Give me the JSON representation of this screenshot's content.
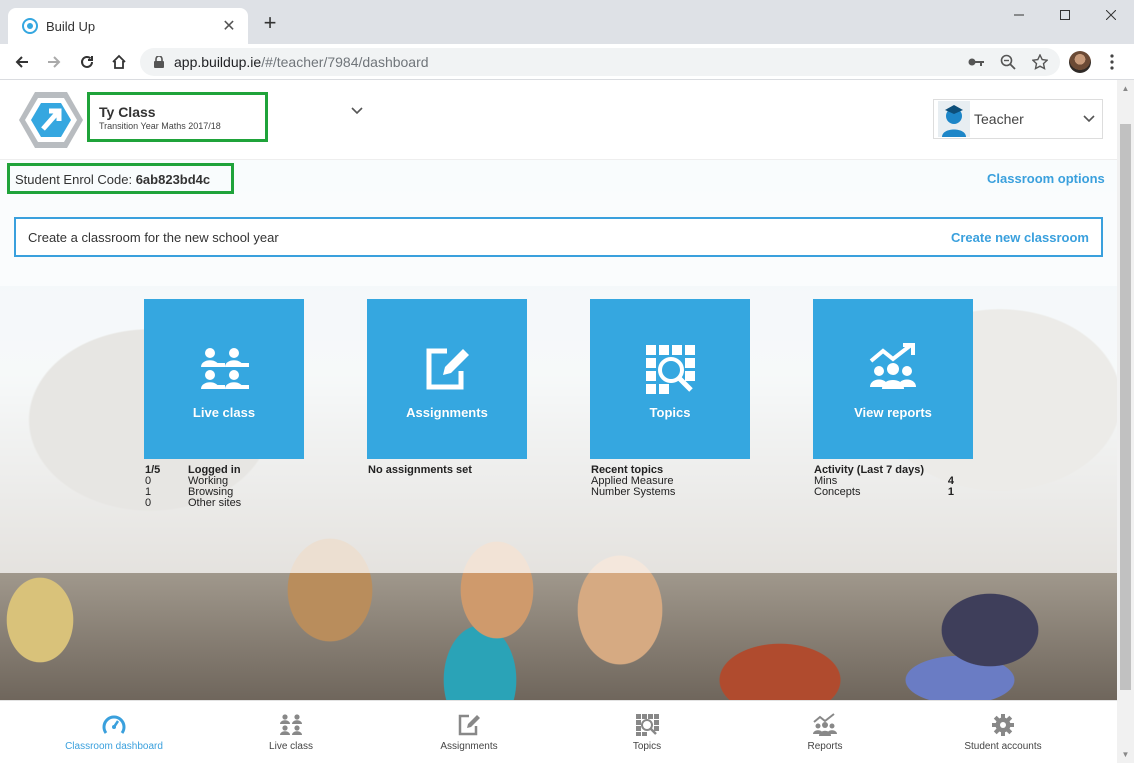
{
  "browser": {
    "tab_title": "Build Up",
    "url_host": "app.buildup.ie",
    "url_path": "/#/teacher/7984/dashboard"
  },
  "header": {
    "class_name": "Ty Class",
    "class_subtitle": "Transition Year Maths 2017/18",
    "user_label": "Teacher"
  },
  "enrol": {
    "label": "Student Enrol Code:",
    "code": "6ab823bd4c"
  },
  "classroom_options": "Classroom options",
  "banner": {
    "text": "Create a classroom for the new school year",
    "link": "Create new classroom"
  },
  "tiles": [
    {
      "label": "Live class",
      "icon": "users-icon"
    },
    {
      "label": "Assignments",
      "icon": "edit-icon"
    },
    {
      "label": "Topics",
      "icon": "topics-search-icon"
    },
    {
      "label": "View reports",
      "icon": "reports-icon"
    }
  ],
  "live_stats": [
    {
      "value": "1/5",
      "label": "Logged in"
    },
    {
      "value": "0",
      "label": "Working"
    },
    {
      "value": "1",
      "label": "Browsing"
    },
    {
      "value": "0",
      "label": "Other sites"
    }
  ],
  "assignments_stat": "No assignments set",
  "topics_stats": {
    "heading": "Recent topics",
    "items": [
      "Applied Measure",
      "Number Systems"
    ]
  },
  "reports_stats": {
    "heading": "Activity (Last 7 days)",
    "rows": [
      {
        "label": "Mins",
        "value": "4"
      },
      {
        "label": "Concepts",
        "value": "1"
      }
    ]
  },
  "bottom_nav": [
    {
      "label": "Classroom dashboard",
      "icon": "gauge-icon",
      "active": true
    },
    {
      "label": "Live class",
      "icon": "users-icon"
    },
    {
      "label": "Assignments",
      "icon": "edit-icon"
    },
    {
      "label": "Topics",
      "icon": "topics-search-icon"
    },
    {
      "label": "Reports",
      "icon": "reports-icon"
    },
    {
      "label": "Student accounts",
      "icon": "gear-icon"
    }
  ],
  "colors": {
    "accent": "#35a7e0",
    "highlight_border": "#1fa33a",
    "link": "#3aa0dd"
  }
}
